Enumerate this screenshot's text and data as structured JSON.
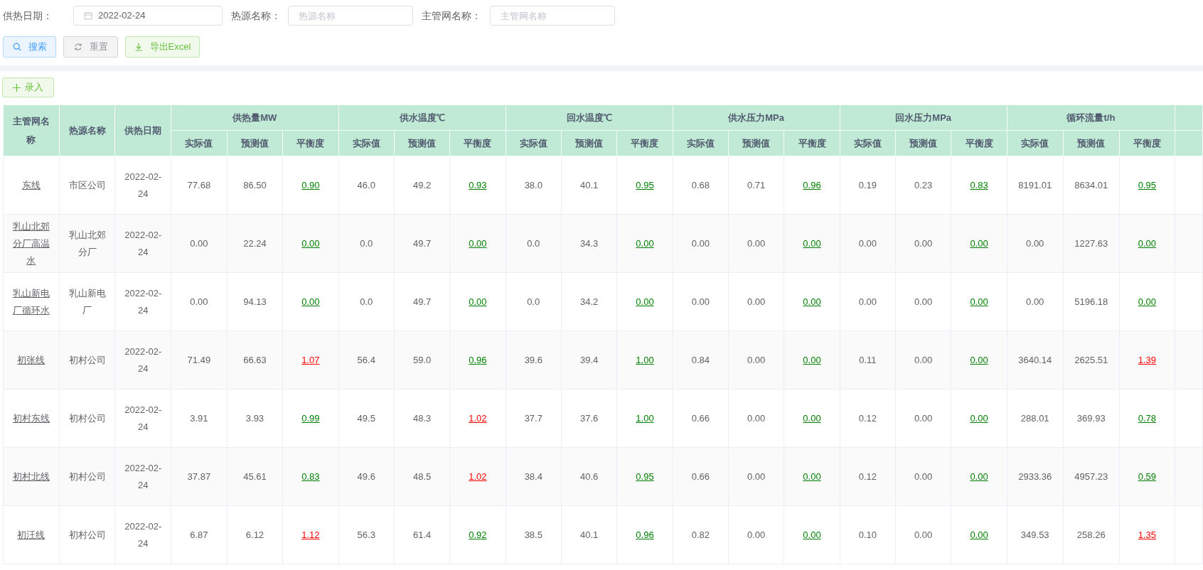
{
  "filters": [
    {
      "label": "供热日期：",
      "kind": "date",
      "value": "2022-02-24"
    },
    {
      "label": "热源名称：",
      "kind": "text",
      "placeholder": "热源名称"
    },
    {
      "label": "主管网名称：",
      "kind": "text",
      "placeholder": "主管网名称"
    }
  ],
  "buttons": [
    {
      "label": "搜索",
      "kind": "search"
    },
    {
      "label": "重置",
      "kind": "reset"
    },
    {
      "label": "导出Excel",
      "kind": "export"
    }
  ],
  "add_button": {
    "label": "录入"
  },
  "table": {
    "columns": [
      "主管网名称",
      "热源名称",
      "供热日期"
    ],
    "groups": [
      {
        "title": "供热量MW",
        "subcolumns": [
          "实际值",
          "预测值",
          "平衡度"
        ]
      },
      {
        "title": "供水温度℃",
        "subcolumns": [
          "实际值",
          "预测值",
          "平衡度"
        ]
      },
      {
        "title": "回水温度℃",
        "subcolumns": [
          "实际值",
          "预测值",
          "平衡度"
        ]
      },
      {
        "title": "供水压力MPa",
        "subcolumns": [
          "实际值",
          "预测值",
          "平衡度"
        ]
      },
      {
        "title": "回水压力MPa",
        "subcolumns": [
          "实际值",
          "预测值",
          "平衡度"
        ]
      },
      {
        "title": "循环流量t/h",
        "subcolumns": [
          "实际值",
          "预测值",
          "平衡度"
        ]
      }
    ],
    "rows": [
      {
        "network": "东线",
        "source": "市区公司",
        "date": "2022-02-24",
        "values": [
          {
            "actual": "77.68",
            "forecast": "86.50",
            "balance": "0.90",
            "color": "#008000"
          },
          {
            "actual": "46.0",
            "forecast": "49.2",
            "balance": "0.93",
            "color": "#008000"
          },
          {
            "actual": "38.0",
            "forecast": "40.1",
            "balance": "0.95",
            "color": "#008000"
          },
          {
            "actual": "0.68",
            "forecast": "0.71",
            "balance": "0.96",
            "color": "#008000"
          },
          {
            "actual": "0.19",
            "forecast": "0.23",
            "balance": "0.83",
            "color": "#008000"
          },
          {
            "actual": "8191.01",
            "forecast": "8634.01",
            "balance": "0.95",
            "color": "#008000"
          }
        ]
      },
      {
        "network": "乳山北郊分厂高温水",
        "source": "乳山北郊分厂",
        "date": "2022-02-24",
        "values": [
          {
            "actual": "0.00",
            "forecast": "22.24",
            "balance": "0.00",
            "color": "#008000"
          },
          {
            "actual": "0.0",
            "forecast": "49.7",
            "balance": "0.00",
            "color": "#008000"
          },
          {
            "actual": "0.0",
            "forecast": "34.3",
            "balance": "0.00",
            "color": "#008000"
          },
          {
            "actual": "0.00",
            "forecast": "0.00",
            "balance": "0.00",
            "color": "#008000"
          },
          {
            "actual": "0.00",
            "forecast": "0.00",
            "balance": "0.00",
            "color": "#008000"
          },
          {
            "actual": "0.00",
            "forecast": "1227.63",
            "balance": "0.00",
            "color": "#008000"
          }
        ]
      },
      {
        "network": "乳山新电厂循环水",
        "source": "乳山新电厂",
        "date": "2022-02-24",
        "values": [
          {
            "actual": "0.00",
            "forecast": "94.13",
            "balance": "0.00",
            "color": "#008000"
          },
          {
            "actual": "0.0",
            "forecast": "49.7",
            "balance": "0.00",
            "color": "#008000"
          },
          {
            "actual": "0.0",
            "forecast": "34.2",
            "balance": "0.00",
            "color": "#008000"
          },
          {
            "actual": "0.00",
            "forecast": "0.00",
            "balance": "0.00",
            "color": "#008000"
          },
          {
            "actual": "0.00",
            "forecast": "0.00",
            "balance": "0.00",
            "color": "#008000"
          },
          {
            "actual": "0.00",
            "forecast": "5196.18",
            "balance": "0.00",
            "color": "#008000"
          }
        ]
      },
      {
        "network": "初张线",
        "source": "初村公司",
        "date": "2022-02-24",
        "values": [
          {
            "actual": "71.49",
            "forecast": "66.63",
            "balance": "1.07",
            "color": "#ff0000"
          },
          {
            "actual": "56.4",
            "forecast": "59.0",
            "balance": "0.96",
            "color": "#008000"
          },
          {
            "actual": "39.6",
            "forecast": "39.4",
            "balance": "1.00",
            "color": "#008000"
          },
          {
            "actual": "0.84",
            "forecast": "0.00",
            "balance": "0.00",
            "color": "#008000"
          },
          {
            "actual": "0.11",
            "forecast": "0.00",
            "balance": "0.00",
            "color": "#008000"
          },
          {
            "actual": "3640.14",
            "forecast": "2625.51",
            "balance": "1.39",
            "color": "#ff0000"
          }
        ]
      },
      {
        "network": "初村东线",
        "source": "初村公司",
        "date": "2022-02-24",
        "values": [
          {
            "actual": "3.91",
            "forecast": "3.93",
            "balance": "0.99",
            "color": "#008000"
          },
          {
            "actual": "49.5",
            "forecast": "48.3",
            "balance": "1.02",
            "color": "#ff0000"
          },
          {
            "actual": "37.7",
            "forecast": "37.6",
            "balance": "1.00",
            "color": "#008000"
          },
          {
            "actual": "0.66",
            "forecast": "0.00",
            "balance": "0.00",
            "color": "#008000"
          },
          {
            "actual": "0.12",
            "forecast": "0.00",
            "balance": "0.00",
            "color": "#008000"
          },
          {
            "actual": "288.01",
            "forecast": "369.93",
            "balance": "0.78",
            "color": "#008000"
          }
        ]
      },
      {
        "network": "初村北线",
        "source": "初村公司",
        "date": "2022-02-24",
        "values": [
          {
            "actual": "37.87",
            "forecast": "45.61",
            "balance": "0.83",
            "color": "#008000"
          },
          {
            "actual": "49.6",
            "forecast": "48.5",
            "balance": "1.02",
            "color": "#ff0000"
          },
          {
            "actual": "38.4",
            "forecast": "40.6",
            "balance": "0.95",
            "color": "#008000"
          },
          {
            "actual": "0.66",
            "forecast": "0.00",
            "balance": "0.00",
            "color": "#008000"
          },
          {
            "actual": "0.12",
            "forecast": "0.00",
            "balance": "0.00",
            "color": "#008000"
          },
          {
            "actual": "2933.36",
            "forecast": "4957.23",
            "balance": "0.59",
            "color": "#008000"
          }
        ]
      },
      {
        "network": "初汪线",
        "source": "初村公司",
        "date": "2022-02-24",
        "values": [
          {
            "actual": "6.87",
            "forecast": "6.12",
            "balance": "1.12",
            "color": "#ff0000"
          },
          {
            "actual": "56.3",
            "forecast": "61.4",
            "balance": "0.92",
            "color": "#008000"
          },
          {
            "actual": "38.5",
            "forecast": "40.1",
            "balance": "0.96",
            "color": "#008000"
          },
          {
            "actual": "0.82",
            "forecast": "0.00",
            "balance": "0.00",
            "color": "#008000"
          },
          {
            "actual": "0.10",
            "forecast": "0.00",
            "balance": "0.00",
            "color": "#008000"
          },
          {
            "actual": "349.53",
            "forecast": "258.26",
            "balance": "1.35",
            "color": "#ff0000"
          }
        ]
      }
    ]
  }
}
